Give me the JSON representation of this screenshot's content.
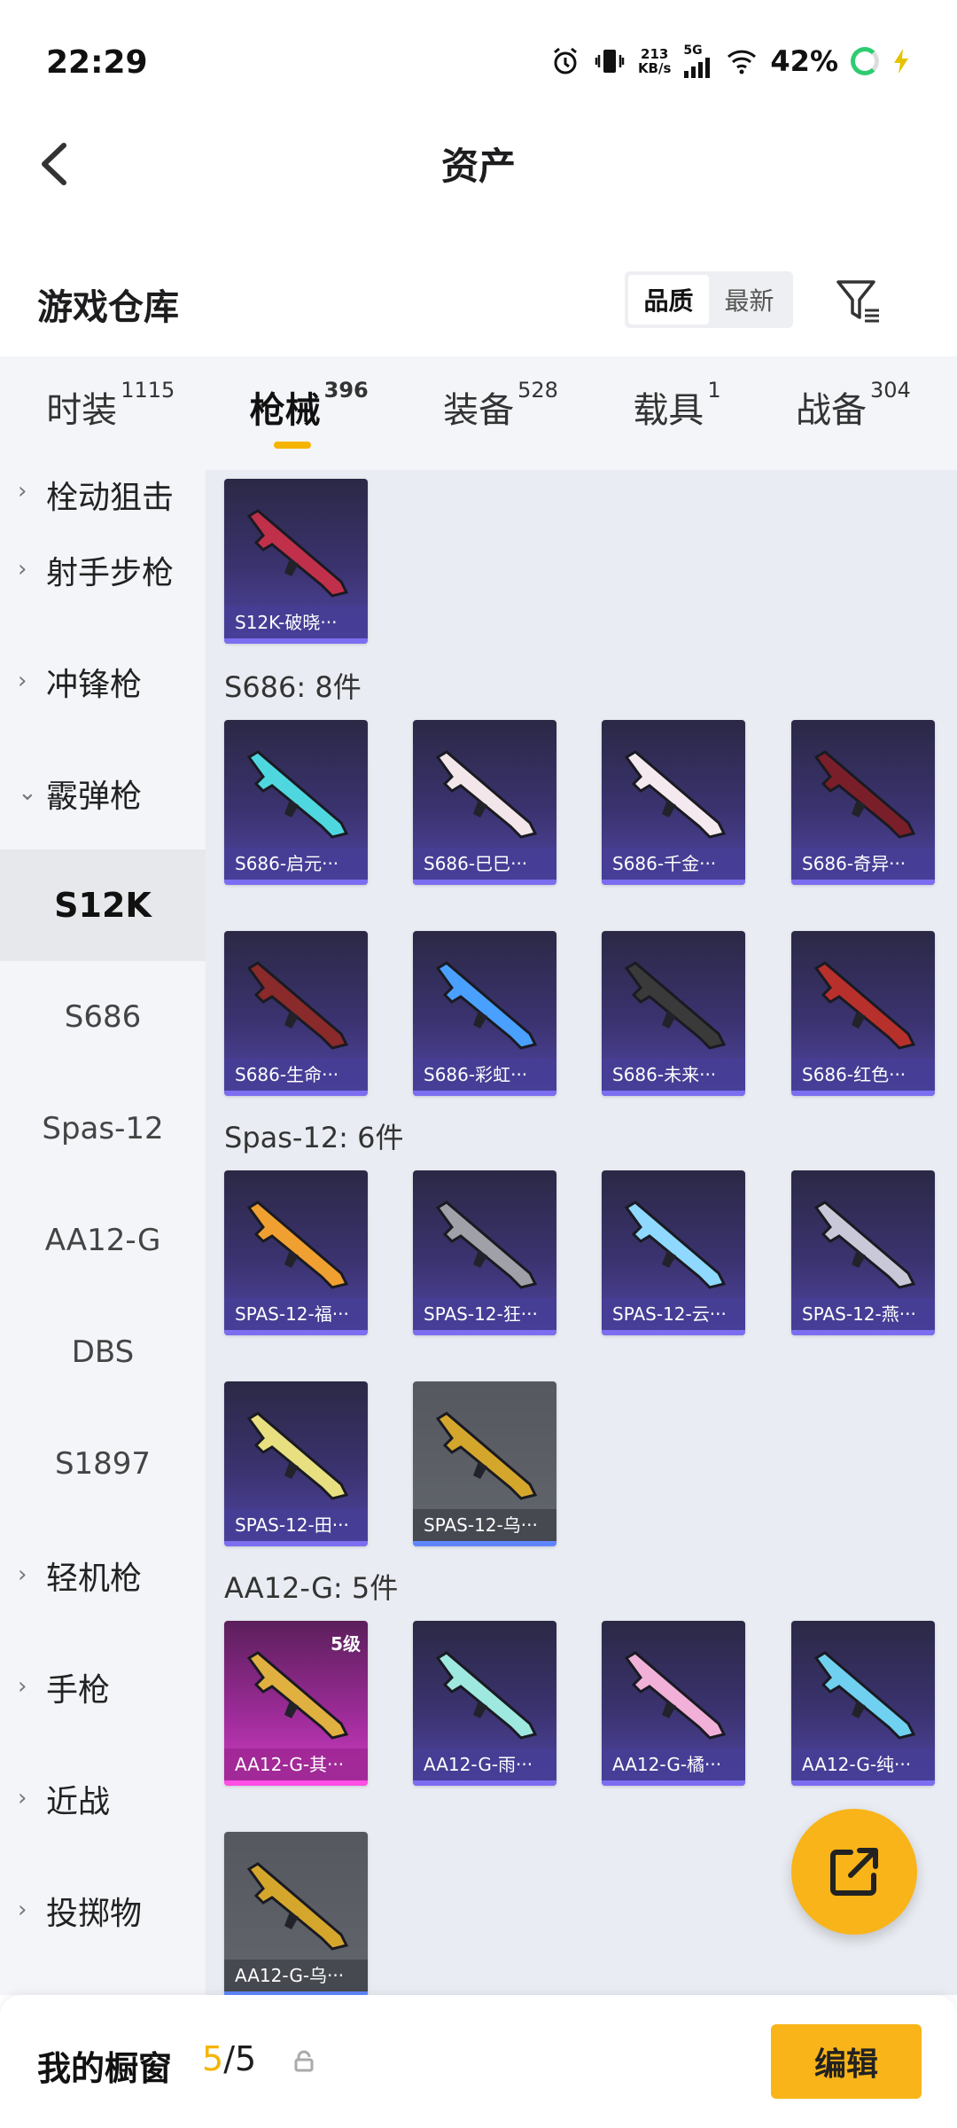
{
  "status_bar": {
    "time": "22:29",
    "net_speed": "213",
    "net_unit": "KB/s",
    "network": "5G",
    "battery": "42%"
  },
  "header": {
    "title": "资产"
  },
  "section": {
    "title": "游戏仓库",
    "sort_options": [
      "品质",
      "最新"
    ],
    "active_sort": "品质"
  },
  "tabs": [
    {
      "label": "时装",
      "count": "1115"
    },
    {
      "label": "枪械",
      "count": "396",
      "active": true
    },
    {
      "label": "装备",
      "count": "528"
    },
    {
      "label": "载具",
      "count": "1"
    },
    {
      "label": "战备",
      "count": "304"
    }
  ],
  "sidebar": [
    {
      "label": "栓动狙击",
      "type": "cat"
    },
    {
      "label": "射手步枪",
      "type": "cat"
    },
    {
      "label": "冲锋枪",
      "type": "cat"
    },
    {
      "label": "霰弹枪",
      "type": "cat",
      "expanded": true
    },
    {
      "label": "S12K",
      "type": "sub",
      "active": true
    },
    {
      "label": "S686",
      "type": "sub"
    },
    {
      "label": "Spas-12",
      "type": "sub"
    },
    {
      "label": "AA12-G",
      "type": "sub"
    },
    {
      "label": "DBS",
      "type": "sub"
    },
    {
      "label": "S1897",
      "type": "sub"
    },
    {
      "label": "轻机枪",
      "type": "cat"
    },
    {
      "label": "手枪",
      "type": "cat"
    },
    {
      "label": "近战",
      "type": "cat"
    },
    {
      "label": "投掷物",
      "type": "cat"
    }
  ],
  "groups": [
    {
      "title": "",
      "items": [
        {
          "name": "S12K-破晓···",
          "rarity": "purple",
          "color": "#c0304a"
        }
      ]
    },
    {
      "title": "S686: 8件",
      "items": [
        {
          "name": "S686-启元···",
          "rarity": "purple",
          "color": "#4fd7e0"
        },
        {
          "name": "S686-巳巳···",
          "rarity": "purple",
          "color": "#f2e6ea"
        },
        {
          "name": "S686-千金···",
          "rarity": "purple",
          "color": "#f4e9ef"
        },
        {
          "name": "S686-奇异···",
          "rarity": "purple",
          "color": "#7a1f2a"
        },
        {
          "name": "S686-生命···",
          "rarity": "purple",
          "color": "#8a2a2a"
        },
        {
          "name": "S686-彩虹···",
          "rarity": "purple",
          "color": "#4aa0ff"
        },
        {
          "name": "S686-未来···",
          "rarity": "purple",
          "color": "#3a3a3a"
        },
        {
          "name": "S686-红色···",
          "rarity": "purple",
          "color": "#b8302c"
        }
      ]
    },
    {
      "title": "Spas-12: 6件",
      "items": [
        {
          "name": "SPAS-12-福···",
          "rarity": "purple",
          "color": "#f0a030"
        },
        {
          "name": "SPAS-12-狂···",
          "rarity": "purple",
          "color": "#9fa0a8"
        },
        {
          "name": "SPAS-12-云···",
          "rarity": "purple",
          "color": "#8fd8ff"
        },
        {
          "name": "SPAS-12-燕···",
          "rarity": "purple",
          "color": "#c8c8d8"
        },
        {
          "name": "SPAS-12-田···",
          "rarity": "purple",
          "color": "#e8e080"
        },
        {
          "name": "SPAS-12-乌···",
          "rarity": "gray",
          "color": "#d4a72c"
        }
      ]
    },
    {
      "title": "AA12-G: 5件",
      "items": [
        {
          "name": "AA12-G-其···",
          "rarity": "pink",
          "color": "#e0b040",
          "level": "5级"
        },
        {
          "name": "AA12-G-雨···",
          "rarity": "purple",
          "color": "#9ee8e0"
        },
        {
          "name": "AA12-G-橘···",
          "rarity": "purple",
          "color": "#f0b0d8"
        },
        {
          "name": "AA12-G-纯···",
          "rarity": "purple",
          "color": "#70d0f0"
        },
        {
          "name": "AA12-G-乌···",
          "rarity": "gray",
          "color": "#d4a72c"
        }
      ]
    }
  ],
  "footer": {
    "showcase_label": "我的橱窗",
    "showcase_current": "5",
    "showcase_total": "/5",
    "edit_label": "编辑"
  }
}
